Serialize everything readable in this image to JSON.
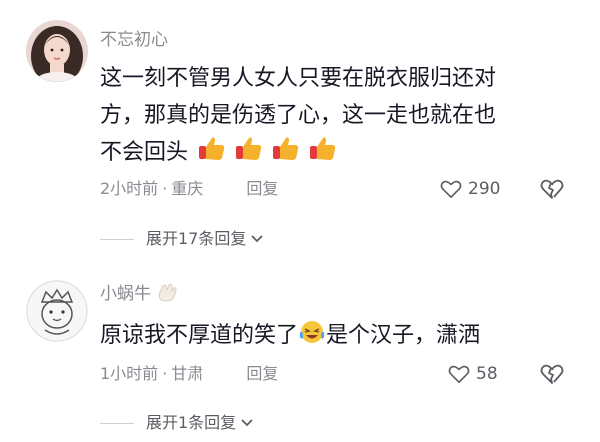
{
  "comments": [
    {
      "username": "不忘初心",
      "text_lines": [
        "这一刻不管男人女人只要在脱衣服归还对",
        "方，那真的是伤透了心，这一走也就在也",
        "不会回头"
      ],
      "emoji_thumbs_count": 4,
      "time": "2小时前",
      "location": "重庆",
      "reply_label": "回复",
      "likes": "290",
      "expand_label": "展开17条回复"
    },
    {
      "username": "小蜗牛",
      "text_before_emoji": "原谅我不厚道的笑了",
      "text_after_emoji": "是个汉子，潇洒",
      "time": "1小时前",
      "location": "甘肃",
      "reply_label": "回复",
      "likes": "58",
      "expand_label": "展开1条回复"
    }
  ]
}
